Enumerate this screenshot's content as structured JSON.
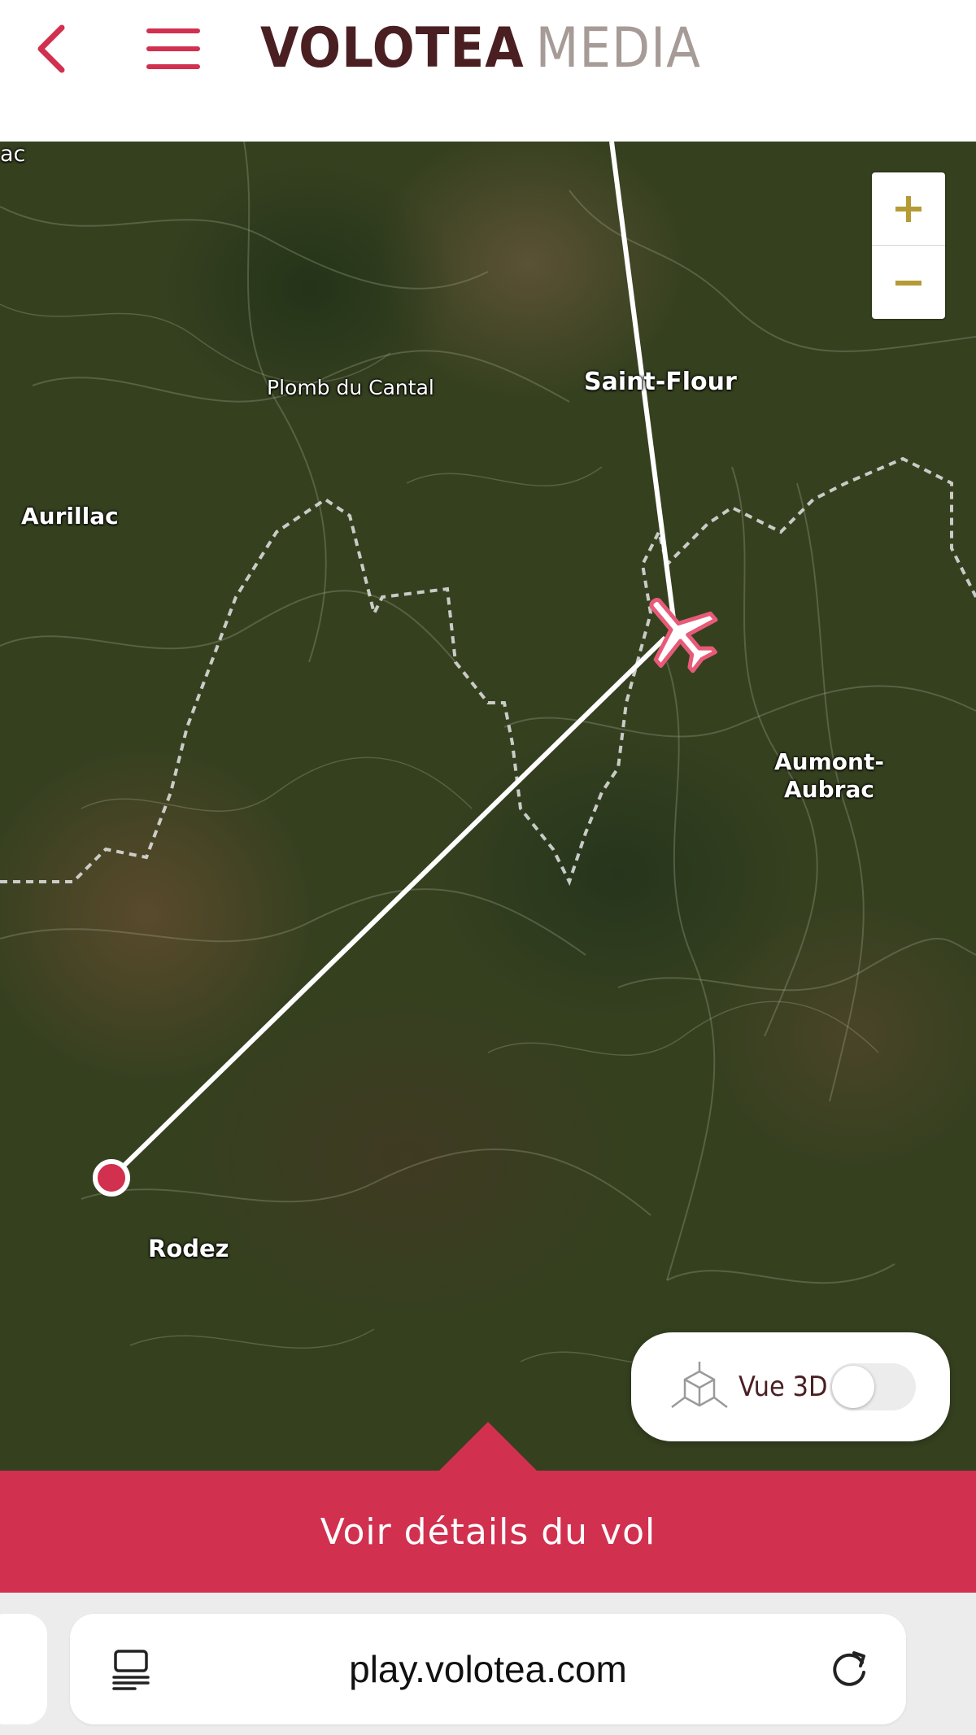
{
  "header": {
    "back_icon": "chevron-left-icon",
    "menu_icon": "hamburger-menu-icon",
    "logo_brand": "VOLOTEA",
    "logo_sub": "MEDIA",
    "accent_color": "#d1304f",
    "brand_color": "#4a1f22"
  },
  "map": {
    "labels": {
      "aurillac_cut": "ac",
      "plomb": "Plomb du Cantal",
      "saint_flour": "Saint-Flour",
      "aurillac": "Aurillac",
      "aumont_line1": "Aumont-",
      "aumont_line2": "Aubrac",
      "rodez": "Rodez"
    },
    "zoom_in_label": "+",
    "zoom_out_label": "−",
    "zoom_color": "#b69a35",
    "toggle_3d": {
      "label": "Vue 3D",
      "enabled": false,
      "icon": "cube-3d-icon"
    },
    "origin_marker_color": "#d1304f",
    "aircraft_icon": "airplane-icon"
  },
  "details_button": {
    "label": "Voir détails du vol"
  },
  "browser": {
    "url": "play.volotea.com",
    "reader_icon": "reader-mode-icon",
    "reload_icon": "reload-icon"
  }
}
